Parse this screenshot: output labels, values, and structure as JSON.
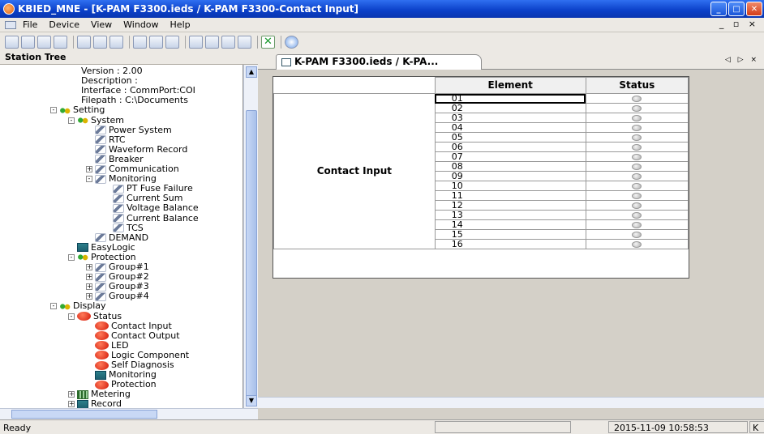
{
  "window": {
    "title": "KBIED_MNE - [K-PAM F3300.ieds / K-PAM F3300-Contact Input]"
  },
  "menu": [
    "File",
    "Device",
    "View",
    "Window",
    "Help"
  ],
  "left_pane": {
    "title": "Station Tree"
  },
  "tree": [
    {
      "label": "Version : 2.00",
      "depth": 3,
      "icon": "none",
      "toggle": ""
    },
    {
      "label": "Description :",
      "depth": 3,
      "icon": "none",
      "toggle": ""
    },
    {
      "label": "Interface : CommPort:COI",
      "depth": 3,
      "icon": "none",
      "toggle": ""
    },
    {
      "label": "Filepath : C:\\Documents",
      "depth": 3,
      "icon": "none",
      "toggle": ""
    },
    {
      "label": "Setting",
      "depth": 0,
      "icon": "gear",
      "toggle": "-"
    },
    {
      "label": "System",
      "depth": 1,
      "icon": "gear",
      "toggle": "-"
    },
    {
      "label": "Power System",
      "depth": 2,
      "icon": "wrench",
      "toggle": ""
    },
    {
      "label": "RTC",
      "depth": 2,
      "icon": "wrench",
      "toggle": ""
    },
    {
      "label": "Waveform Record",
      "depth": 2,
      "icon": "wrench",
      "toggle": ""
    },
    {
      "label": "Breaker",
      "depth": 2,
      "icon": "wrench",
      "toggle": ""
    },
    {
      "label": "Communication",
      "depth": 2,
      "icon": "wrench",
      "toggle": "+"
    },
    {
      "label": "Monitoring",
      "depth": 2,
      "icon": "wrench",
      "toggle": "-"
    },
    {
      "label": "PT Fuse Failure",
      "depth": 3,
      "icon": "wrench",
      "toggle": ""
    },
    {
      "label": "Current Sum",
      "depth": 3,
      "icon": "wrench",
      "toggle": ""
    },
    {
      "label": "Voltage Balance",
      "depth": 3,
      "icon": "wrench",
      "toggle": ""
    },
    {
      "label": "Current Balance",
      "depth": 3,
      "icon": "wrench",
      "toggle": ""
    },
    {
      "label": "TCS",
      "depth": 3,
      "icon": "wrench",
      "toggle": ""
    },
    {
      "label": "DEMAND",
      "depth": 2,
      "icon": "wrench",
      "toggle": ""
    },
    {
      "label": "EasyLogic",
      "depth": 1,
      "icon": "green",
      "toggle": ""
    },
    {
      "label": "Protection",
      "depth": 1,
      "icon": "gear",
      "toggle": "-"
    },
    {
      "label": "Group#1",
      "depth": 2,
      "icon": "wrench",
      "toggle": "+"
    },
    {
      "label": "Group#2",
      "depth": 2,
      "icon": "wrench",
      "toggle": "+"
    },
    {
      "label": "Group#3",
      "depth": 2,
      "icon": "wrench",
      "toggle": "+"
    },
    {
      "label": "Group#4",
      "depth": 2,
      "icon": "wrench",
      "toggle": "+"
    },
    {
      "label": "Display",
      "depth": 0,
      "icon": "gear",
      "toggle": "-"
    },
    {
      "label": "Status",
      "depth": 1,
      "icon": "red",
      "toggle": "-"
    },
    {
      "label": "Contact Input",
      "depth": 2,
      "icon": "red",
      "toggle": ""
    },
    {
      "label": "Contact Output",
      "depth": 2,
      "icon": "red",
      "toggle": ""
    },
    {
      "label": "LED",
      "depth": 2,
      "icon": "red",
      "toggle": ""
    },
    {
      "label": "Logic Component",
      "depth": 2,
      "icon": "red",
      "toggle": ""
    },
    {
      "label": "Self Diagnosis",
      "depth": 2,
      "icon": "red",
      "toggle": ""
    },
    {
      "label": "Monitoring",
      "depth": 2,
      "icon": "green",
      "toggle": ""
    },
    {
      "label": "Protection",
      "depth": 2,
      "icon": "red",
      "toggle": ""
    },
    {
      "label": "Metering",
      "depth": 1,
      "icon": "grid",
      "toggle": "+"
    },
    {
      "label": "Record",
      "depth": 1,
      "icon": "green",
      "toggle": "+"
    }
  ],
  "tab": {
    "label": "K-PAM F3300.ieds / K-PA..."
  },
  "table": {
    "headers": [
      "Element",
      "Status"
    ],
    "group_label": "Contact Input",
    "elements": [
      "01",
      "02",
      "03",
      "04",
      "05",
      "06",
      "07",
      "08",
      "09",
      "10",
      "11",
      "12",
      "13",
      "14",
      "15",
      "16"
    ]
  },
  "status": {
    "ready": "Ready",
    "datetime": "2015-11-09 10:58:53",
    "extra": "K"
  }
}
